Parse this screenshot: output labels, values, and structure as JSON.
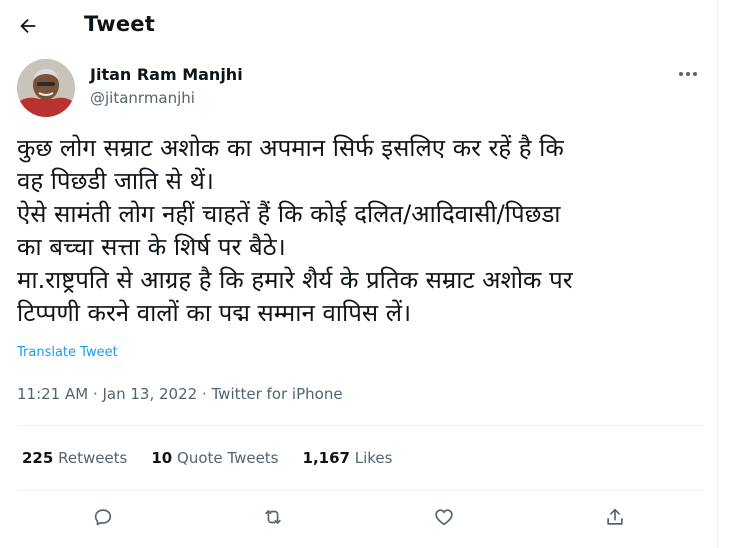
{
  "header": {
    "title": "Tweet"
  },
  "author": {
    "name": "Jitan Ram Manjhi",
    "handle": "@jitanrmanjhi"
  },
  "tweet": {
    "lines": [
      "कुछ लोग सम्राट अशोक का अपमान सिर्फ इसलिए कर रहें है कि",
      "वह पिछडी जाति से थें।",
      "ऐसे सामंती लोग नहीं चाहतें हैं कि कोई दलित/आदिवासी/पिछडा",
      "का बच्चा सत्ता के शिर्ष पर बैठे।",
      "मा.राष्ट्रपति से आग्रह है कि हमारे शैर्य के प्रतिक सम्राट अशोक पर",
      "टिप्पणी करने वालों का पद्म सम्मान वापिस लें।"
    ],
    "translate_label": "Translate Tweet",
    "meta": "11:21 AM · Jan 13, 2022 · Twitter for iPhone"
  },
  "stats": {
    "retweets_count": "225",
    "retweets_label": "Retweets",
    "quotes_count": "10",
    "quotes_label": "Quote Tweets",
    "likes_count": "1,167",
    "likes_label": "Likes"
  },
  "icons": {
    "back": "arrow-left-icon",
    "more": "more-horizontal-icon",
    "reply": "reply-icon",
    "retweet": "retweet-icon",
    "like": "heart-icon",
    "share": "share-icon"
  },
  "colors": {
    "link": "#1d9bf0",
    "secondary": "#536471",
    "text": "#0f1419"
  }
}
